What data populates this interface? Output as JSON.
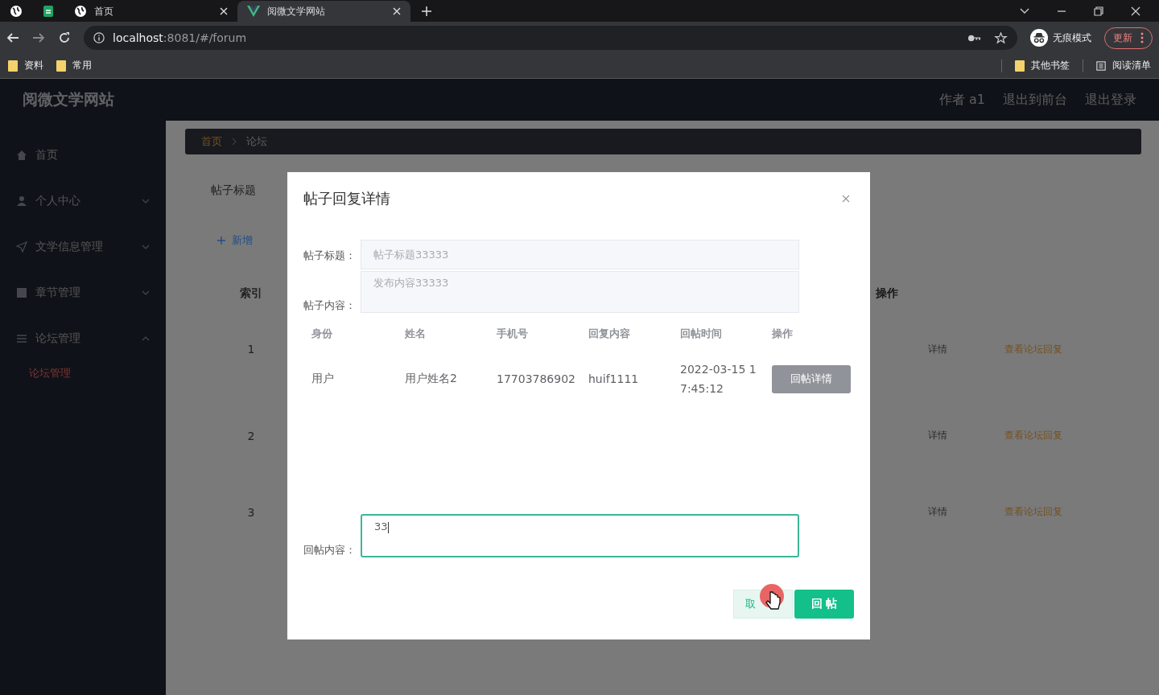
{
  "browser": {
    "tabs": [
      {
        "kind": "globe",
        "selected": false
      },
      {
        "kind": "sheet",
        "selected": false
      },
      {
        "kind": "globe",
        "label": "首页",
        "selected": false
      },
      {
        "kind": "vue",
        "label": "阅微文学网站",
        "selected": true
      }
    ],
    "address": {
      "host": "localhost",
      "path": ":8081/#/forum"
    },
    "profile": "无痕模式",
    "update_button": "更新",
    "bookmarks": [
      "资料",
      "常用"
    ],
    "other_bookmarks": "其他书签",
    "reading_list": "阅读清单"
  },
  "header": {
    "title": "阅微文学网站",
    "links": [
      "作者 a1",
      "退出到前台",
      "退出登录"
    ]
  },
  "sidebar": {
    "items": [
      {
        "kind": "home",
        "label": "首页"
      },
      {
        "kind": "user",
        "label": "个人中心",
        "expanded": false
      },
      {
        "kind": "send",
        "label": "文学信息管理",
        "expanded": false
      },
      {
        "kind": "image",
        "label": "章节管理",
        "expanded": false
      },
      {
        "kind": "list",
        "label": "论坛管理",
        "expanded": true,
        "children": [
          {
            "label": "论坛管理",
            "selected": true
          }
        ]
      }
    ]
  },
  "breadcrumb": [
    "首页",
    "论坛"
  ],
  "search_label": "帖子标题",
  "add_button": "新增",
  "table": {
    "columns": [
      "索引",
      "操作"
    ],
    "rows": [
      {
        "index": "1",
        "detail": "详情",
        "replies": "查看论坛回复"
      },
      {
        "index": "2",
        "detail": "详情",
        "replies": "查看论坛回复"
      },
      {
        "index": "3",
        "detail": "详情",
        "replies": "查看论坛回复"
      }
    ]
  },
  "dialog": {
    "title": "帖子回复详情",
    "fields": [
      {
        "label": "帖子标题：",
        "value": "帖子标题33333"
      },
      {
        "label": "帖子内容：",
        "value": "发布内容33333"
      }
    ],
    "columns": [
      "身份",
      "姓名",
      "手机号",
      "回复内容",
      "回帖时间",
      "操作"
    ],
    "rows": [
      {
        "role": "用户",
        "name": "用户姓名2",
        "phone": "17703786902",
        "content": "huif1111",
        "time": "2022-03-15 17:45:12",
        "action": "回帖详情"
      }
    ],
    "reply": {
      "label": "回帖内容：",
      "value": "33"
    },
    "cancel_button": "取",
    "submit_button": "回 帖"
  }
}
